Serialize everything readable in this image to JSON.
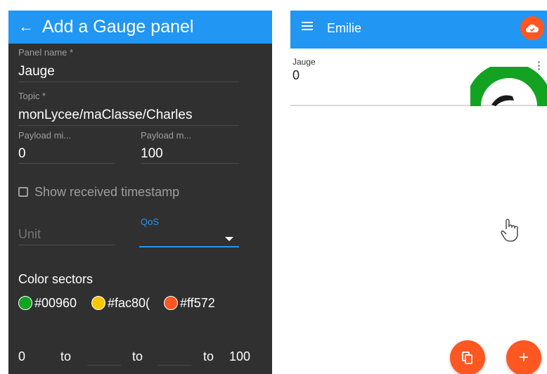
{
  "editor": {
    "title": "Add a Gauge panel",
    "panel_name": {
      "label": "Panel name *",
      "value": "Jauge"
    },
    "topic": {
      "label": "Topic *",
      "value": "monLycee/maClasse/Charles"
    },
    "payload_min": {
      "label": "Payload mi...",
      "value": "0"
    },
    "payload_max": {
      "label": "Payload m...",
      "value": "100"
    },
    "show_timestamp": {
      "label": "Show received timestamp",
      "checked": false
    },
    "unit": {
      "placeholder": "Unit"
    },
    "qos": {
      "label": "QoS",
      "value": ""
    },
    "color_sectors": {
      "title": "Color sectors",
      "items": [
        {
          "color": "#009688",
          "text": "#00960"
        },
        {
          "color": "#fac800",
          "text": "#fac80("
        },
        {
          "color": "#ff5722",
          "text": "#ff572"
        }
      ]
    },
    "range": {
      "start": "0",
      "to1": "to",
      "to2": "to",
      "to3": "to",
      "end": "100"
    }
  },
  "dashboard": {
    "title": "Emilie",
    "panel": {
      "title": "Jauge",
      "value": "0",
      "gauge_fraction": 0.0
    },
    "icons": {
      "menu": "menu-icon",
      "cloud": "cloud-icon",
      "copy": "copy-icon",
      "add": "add-icon",
      "more": "more-vert-icon",
      "cursor": "hand-cursor-icon"
    }
  },
  "colors": {
    "primary": "#2196f3",
    "accent": "#ff5722",
    "gauge_green": "#13a321",
    "editor_bg": "#303030"
  }
}
